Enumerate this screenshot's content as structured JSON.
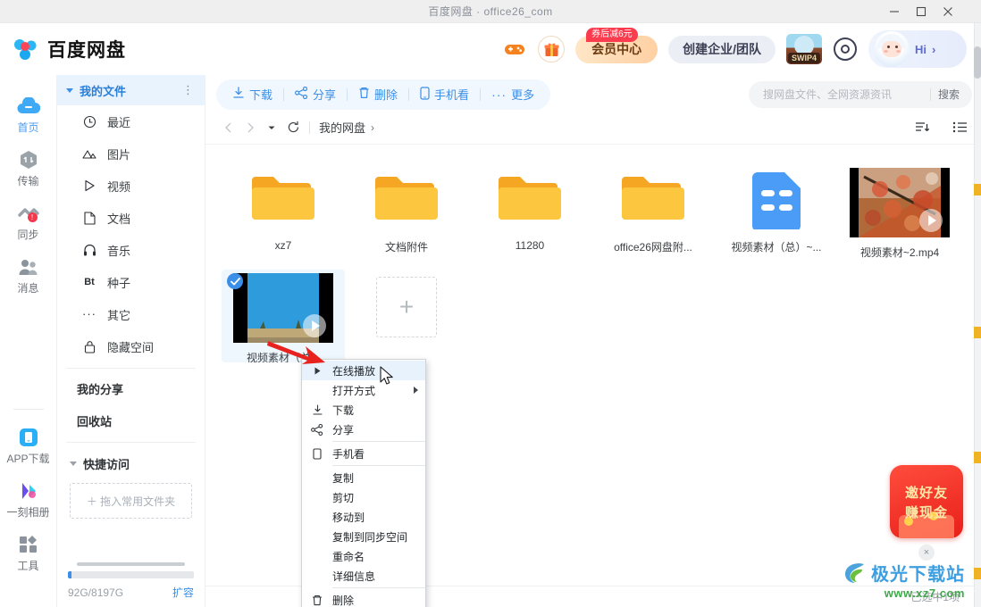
{
  "window": {
    "title": "百度网盘 · office26_com",
    "controls": {
      "minimize": "minimize-icon",
      "maximize": "maximize-icon",
      "close": "close-icon"
    }
  },
  "header": {
    "brand": "百度网盘",
    "game_icon": "gamepad-icon",
    "gift_icon": "gift-icon",
    "vip": {
      "label": "会员中心",
      "badge": "券后减6元"
    },
    "team": {
      "label": "创建企业/团队"
    },
    "swip": {
      "label": "SWIP4"
    },
    "target_icon": "target-icon",
    "user": {
      "greeting": "Hi",
      "chevron": "›"
    }
  },
  "rail": {
    "items": [
      {
        "label": "首页",
        "icon": "cloud-icon",
        "active": true,
        "badge": ""
      },
      {
        "label": "传输",
        "icon": "transfer-icon",
        "active": false,
        "badge": ""
      },
      {
        "label": "同步",
        "icon": "sync-icon",
        "active": false,
        "badge": "!"
      },
      {
        "label": "消息",
        "icon": "people-icon",
        "active": false,
        "badge": ""
      }
    ],
    "bottom_items": [
      {
        "label": "APP下载",
        "icon": "phone-app-icon"
      },
      {
        "label": "一刻相册",
        "icon": "album-icon"
      },
      {
        "label": "工具",
        "icon": "tools-icon"
      }
    ]
  },
  "tree": {
    "header": {
      "label": "我的文件",
      "more_icon": "more-vertical-icon"
    },
    "items": [
      {
        "label": "最近",
        "icon": "clock-icon"
      },
      {
        "label": "图片",
        "icon": "image-icon"
      },
      {
        "label": "视频",
        "icon": "video-icon"
      },
      {
        "label": "文档",
        "icon": "document-icon"
      },
      {
        "label": "音乐",
        "icon": "headphone-icon"
      },
      {
        "label": "种子",
        "icon": "bt-icon"
      },
      {
        "label": "其它",
        "icon": "ellipsis-icon"
      },
      {
        "label": "隐藏空间",
        "icon": "lock-icon"
      }
    ],
    "plain_items": [
      {
        "label": "我的分享"
      },
      {
        "label": "回收站"
      }
    ],
    "quick": {
      "label": "快捷访问",
      "dropzone": "＋ 拖入常用文件夹"
    },
    "storage": {
      "used_percent": 3,
      "text": "92G/8197G",
      "link": "扩容"
    }
  },
  "toolbar": {
    "buttons": [
      {
        "label": "下载",
        "icon": "download-icon"
      },
      {
        "label": "分享",
        "icon": "share-icon"
      },
      {
        "label": "删除",
        "icon": "trash-icon"
      },
      {
        "label": "手机看",
        "icon": "phone-icon"
      },
      {
        "label": "更多",
        "icon": "ellipsis-icon"
      }
    ],
    "search": {
      "placeholder": "搜网盘文件、全网资源资讯",
      "value": "",
      "button": "搜索"
    }
  },
  "crumbbar": {
    "back_icon": "chevron-left-icon",
    "forward_icon": "chevron-right-icon",
    "dropdown_icon": "caret-down-icon",
    "refresh_icon": "refresh-icon",
    "path": [
      {
        "label": "我的网盘",
        "sep": "›"
      }
    ],
    "sort_icon": "sort-icon",
    "view_icon": "list-view-icon"
  },
  "files": [
    {
      "name": "xz7",
      "type": "folder",
      "selected": false
    },
    {
      "name": "文档附件",
      "type": "folder",
      "selected": false
    },
    {
      "name": "11280",
      "type": "folder",
      "selected": false
    },
    {
      "name": "office26网盘附...",
      "type": "folder",
      "selected": false
    },
    {
      "name": "视频素材（总）~...",
      "type": "doc",
      "selected": false
    },
    {
      "name": "视频素材~2.mp4",
      "type": "video-autumn",
      "selected": false
    },
    {
      "name": "视频素材（总...",
      "type": "video-sky",
      "selected": true
    }
  ],
  "add_cell": {
    "label": "+"
  },
  "context_menu": {
    "items": [
      {
        "label": "在线播放",
        "icon": "play-icon",
        "highlight": true,
        "submenu": false,
        "sep_after": false
      },
      {
        "label": "打开方式",
        "icon": "",
        "highlight": false,
        "submenu": true,
        "sep_after": false
      },
      {
        "label": "下载",
        "icon": "download-icon",
        "highlight": false,
        "submenu": false,
        "sep_after": false
      },
      {
        "label": "分享",
        "icon": "share-icon",
        "highlight": false,
        "submenu": false,
        "sep_after": true
      },
      {
        "label": "手机看",
        "icon": "phone-icon",
        "highlight": false,
        "submenu": false,
        "sep_after": true
      },
      {
        "label": "复制",
        "icon": "",
        "highlight": false,
        "submenu": false,
        "sep_after": false
      },
      {
        "label": "剪切",
        "icon": "",
        "highlight": false,
        "submenu": false,
        "sep_after": false
      },
      {
        "label": "移动到",
        "icon": "",
        "highlight": false,
        "submenu": false,
        "sep_after": false
      },
      {
        "label": "复制到同步空间",
        "icon": "",
        "highlight": false,
        "submenu": false,
        "sep_after": false
      },
      {
        "label": "重命名",
        "icon": "",
        "highlight": false,
        "submenu": false,
        "sep_after": false
      },
      {
        "label": "详细信息",
        "icon": "",
        "highlight": false,
        "submenu": false,
        "sep_after": true
      },
      {
        "label": "删除",
        "icon": "trash-icon",
        "highlight": false,
        "submenu": false,
        "sep_after": false
      }
    ]
  },
  "promo": {
    "line1": "邀好友",
    "line2": "赚现金",
    "close": "×"
  },
  "status": {
    "text": "已选中1项"
  },
  "watermark": {
    "main": "极光下载站",
    "sub": "www.xz7.com"
  },
  "colors": {
    "accent": "#3b8fe8",
    "folder": "#fcc63f",
    "vip": "#ffd0a3",
    "danger": "#f5384e",
    "selected_bg": "#eef6fe"
  }
}
